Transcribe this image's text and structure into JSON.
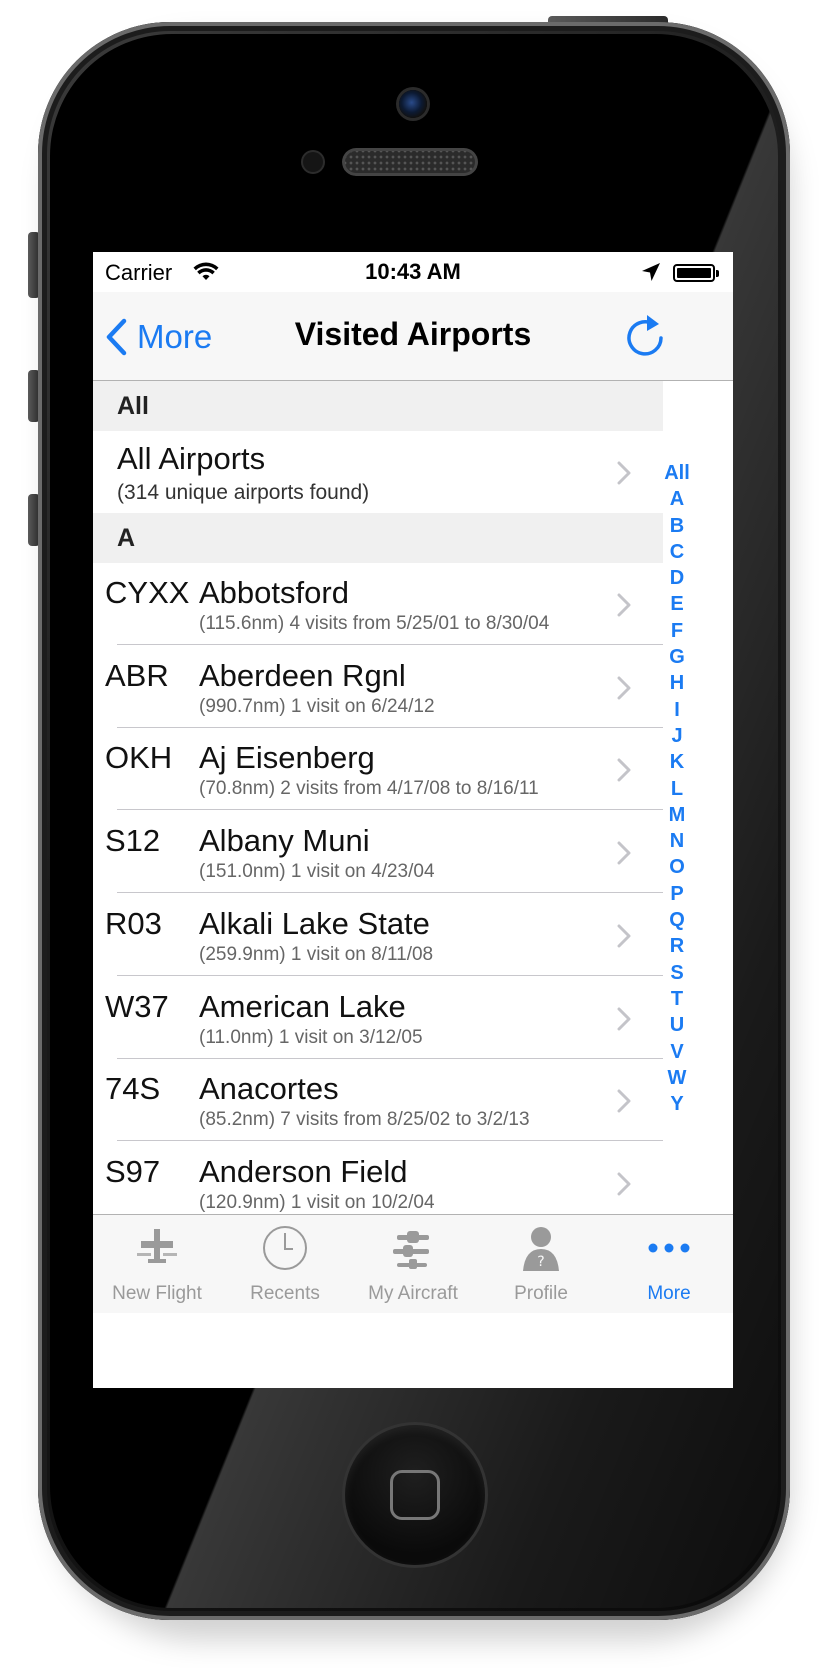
{
  "status_bar": {
    "carrier": "Carrier",
    "time": "10:43 AM",
    "wifi_icon": "wifi-icon",
    "location_icon": "location-arrow-icon",
    "battery_icon": "battery-full-icon"
  },
  "nav": {
    "back_label": "More",
    "title": "Visited Airports",
    "refresh_icon": "refresh-icon",
    "accent_color": "#1b7bf2"
  },
  "sections": {
    "all_header": "All",
    "all_row": {
      "title": "All Airports",
      "detail": "(314 unique airports found)"
    },
    "a_header": "A"
  },
  "airports": [
    {
      "code": "CYXX",
      "name": "Abbotsford",
      "detail": "(115.6nm) 4 visits from 5/25/01 to 8/30/04"
    },
    {
      "code": "ABR",
      "name": "Aberdeen Rgnl",
      "detail": "(990.7nm) 1 visit on 6/24/12"
    },
    {
      "code": "OKH",
      "name": "Aj Eisenberg",
      "detail": "(70.8nm) 2 visits from 4/17/08 to 8/16/11"
    },
    {
      "code": "S12",
      "name": "Albany Muni",
      "detail": "(151.0nm) 1 visit on 4/23/04"
    },
    {
      "code": "R03",
      "name": "Alkali Lake State",
      "detail": "(259.9nm) 1 visit on 8/11/08"
    },
    {
      "code": "W37",
      "name": "American Lake",
      "detail": "(11.0nm) 1 visit on 3/12/05"
    },
    {
      "code": "74S",
      "name": "Anacortes",
      "detail": "(85.2nm) 7 visits from 8/25/02 to 3/2/13"
    },
    {
      "code": "S97",
      "name": "Anderson Field",
      "detail": "(120.9nm) 1 visit on 10/2/04"
    }
  ],
  "index_letters": [
    "All",
    "A",
    "B",
    "C",
    "D",
    "E",
    "F",
    "G",
    "H",
    "I",
    "J",
    "K",
    "L",
    "M",
    "N",
    "O",
    "P",
    "Q",
    "R",
    "S",
    "T",
    "U",
    "V",
    "W",
    "Y"
  ],
  "tabs": [
    {
      "label": "New Flight",
      "icon": "new-flight-icon"
    },
    {
      "label": "Recents",
      "icon": "clock-icon"
    },
    {
      "label": "My Aircraft",
      "icon": "aircraft-icon"
    },
    {
      "label": "Profile",
      "icon": "profile-icon"
    },
    {
      "label": "More",
      "icon": "more-dots-icon",
      "active": true
    }
  ]
}
